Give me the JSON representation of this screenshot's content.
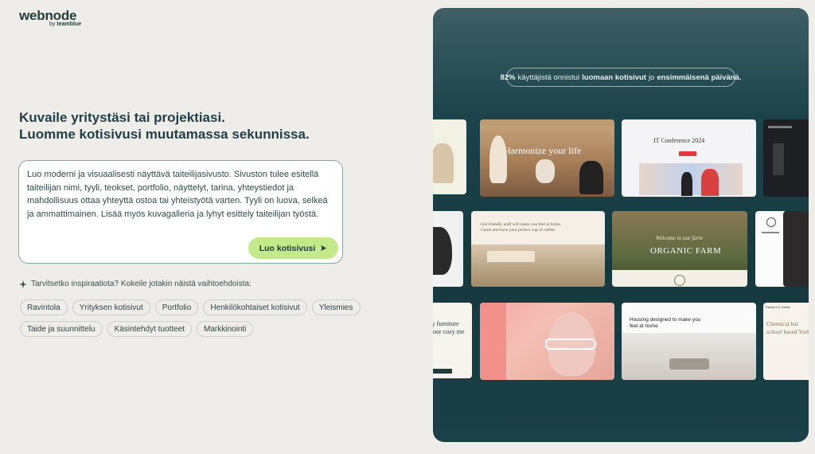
{
  "logo": {
    "brand": "webnode",
    "by": "by",
    "parent": "teamblue"
  },
  "headline": {
    "line1": "Kuvaile yritystäsi tai projektiasi.",
    "line2": "Luomme kotisivusi muutamassa sekunnissa."
  },
  "prompt": {
    "value": "Luo moderni ja visuaalisesti näyttävä taiteilijasivusto. Sivuston tulee esitellä taiteilijan nimi, tyyli, teokset, portfolio, näyttelyt, tarina, yhteystiedot ja mahdollisuus ottaa yhteyttä ostoa tai yhteistyötä varten. Tyyli on luova, selkeä ja ammattimainen. Lisää myös kuvagalleria ja lyhyt esittely taiteilijan työstä.",
    "button_label": "Luo kotisivusi",
    "button_icon": "arrow-right-icon"
  },
  "inspiration": {
    "icon": "sparkle-icon",
    "text": "Tarvitsetko inspiraatiota? Kokeile jotakin näistä vaihtoehdoista:",
    "chips_row1": [
      "Ravintola",
      "Yrityksen kotisivut",
      "Portfolio",
      "Henkilökohtaiset kotisivut",
      "Yleismies"
    ],
    "chips_row2": [
      "Taide ja suunnittelu",
      "Käsintehdyt tuotteet",
      "Markkinointi"
    ]
  },
  "showcase": {
    "stat_pct": "82%",
    "stat_mid": "käyttäjistä onnistui",
    "stat_bold1": "luomaan kotisivut",
    "stat_mid2": "jo",
    "stat_bold2": "ensimmäisenä päivänä.",
    "cards": {
      "yoga_title": "Harmonize your life",
      "conf_title": "IT Conference 2024",
      "cafe_text": "Our friendly staff will make you feel at home. Come and have your perfect cup of coffee.",
      "farm_title": "ORGANIC FARM",
      "farm_script": "Welcome to our farm",
      "furniture_text": "ry furniture your cozy me",
      "housing_text": "Housing designed to make you feel at home",
      "chemical_text": "Chemical bal school based York",
      "painter_label": "Painters & Tables"
    },
    "colors": {
      "accent": "#c5e88a",
      "panel": "#1c434a"
    }
  }
}
